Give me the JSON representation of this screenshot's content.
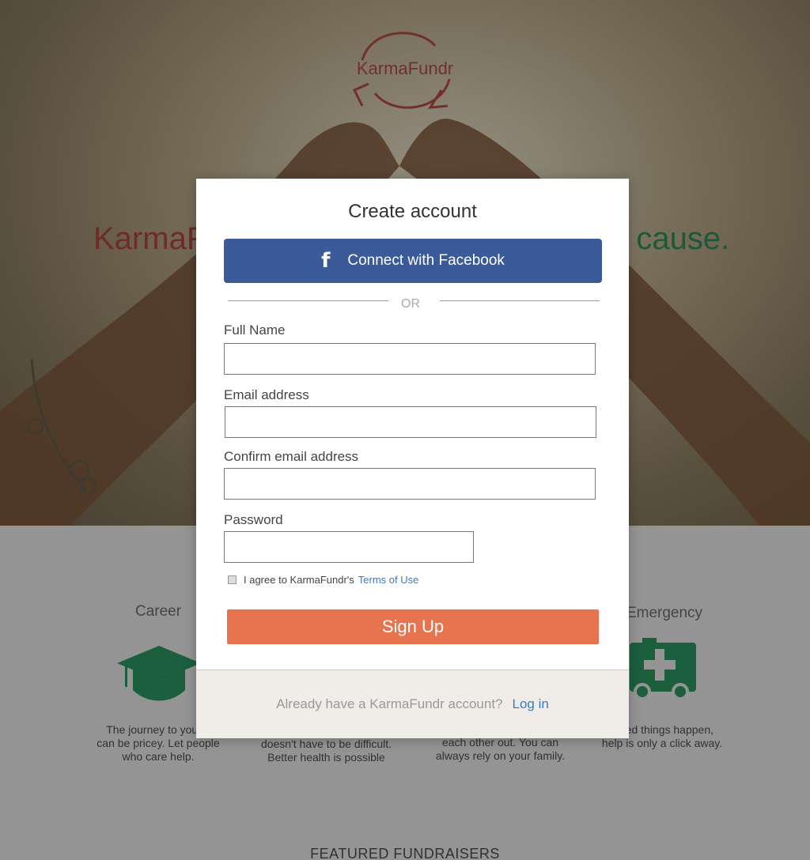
{
  "colors": {
    "brand_red": "#c6524a",
    "facebook_blue": "#3b5a9a",
    "signup_orange": "#e8734f",
    "link_blue": "#3b7bc4",
    "accent_green": "#2f9a64"
  },
  "header": {
    "logo_text": "KarmaFundr",
    "tagline_left": "KarmaF",
    "tagline_right": "r cause."
  },
  "features": [
    {
      "title": "Career",
      "icon": "graduation-cap-icon",
      "text_lines": [
        "The journey to your c",
        "can be pricey. Let people",
        "who care help."
      ]
    },
    {
      "title": "",
      "icon": "",
      "text_lines": [
        "doesn't have to be difficult.",
        "Better health is possible"
      ]
    },
    {
      "title": "",
      "icon": "",
      "text_lines": [
        "each other out. You can",
        "always rely on your family."
      ]
    },
    {
      "title": "Emergency",
      "icon": "ambulance-icon",
      "text_lines": [
        "ected things happen,",
        "help is only a click away."
      ]
    }
  ],
  "featured_heading": "FEATURED FUNDRAISERS",
  "modal": {
    "title": "Create account",
    "facebook_icon": "facebook-icon",
    "facebook_label": "Connect with Facebook",
    "or_text": "OR",
    "fields": {
      "full_name": {
        "label": "Full Name",
        "value": ""
      },
      "email": {
        "label": "Email address",
        "value": ""
      },
      "confirm_email": {
        "label": "Confirm email address",
        "value": ""
      },
      "password": {
        "label": "Password",
        "value": ""
      }
    },
    "agree_text": "I agree to KarmaFundr's",
    "terms_link": "Terms of Use",
    "agree_checked": false,
    "signup_label": "Sign Up",
    "footer_text": "Already have a KarmaFundr account?",
    "login_link": "Log in"
  }
}
